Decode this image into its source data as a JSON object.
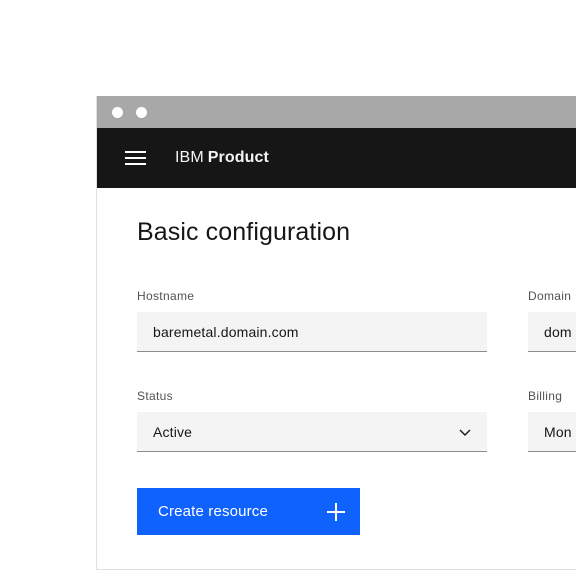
{
  "window": {
    "title_bar": {
      "dots": [
        "window-dot-1",
        "window-dot-2"
      ]
    }
  },
  "header": {
    "menu_icon": "hamburger-menu-icon",
    "brand": "IBM",
    "product": "Product"
  },
  "main": {
    "page_title": "Basic configuration",
    "fields": [
      {
        "label": "Hostname",
        "value": "baremetal.domain.com",
        "type": "text"
      },
      {
        "label": "Domain",
        "value": "dom",
        "type": "text"
      },
      {
        "label": "Status",
        "value": "Active",
        "type": "select",
        "icon": "chevron-down-icon"
      },
      {
        "label": "Billing",
        "value": "Mon",
        "type": "select",
        "icon": "chevron-down-icon"
      }
    ],
    "primary_button": {
      "label": "Create resource",
      "icon": "add-icon"
    }
  },
  "colors": {
    "title_bar": "#a8a8a8",
    "header_background": "#161616",
    "primary_blue": "#0f62fe",
    "field_background": "#f4f4f4",
    "field_underline": "#8d8d8d",
    "label_text": "#525252",
    "body_text": "#161616",
    "window_border": "#e0e0e0"
  }
}
